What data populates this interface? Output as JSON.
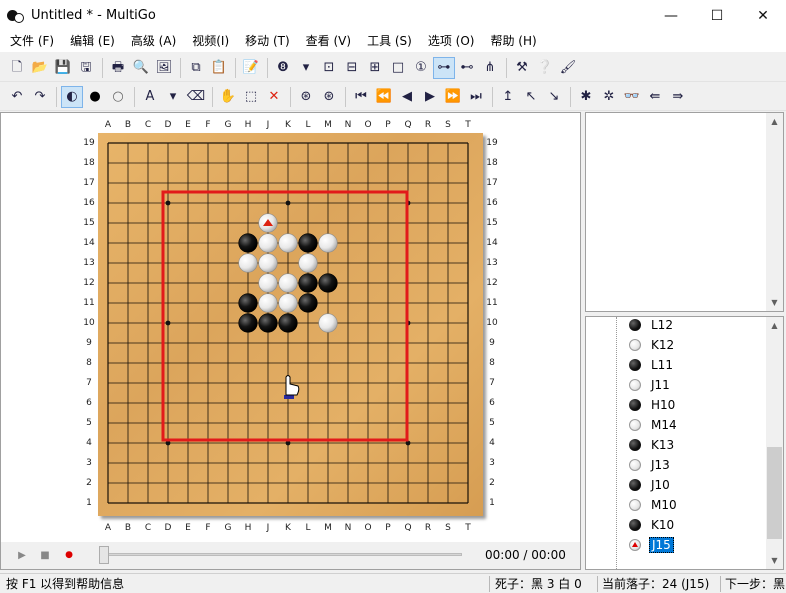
{
  "window": {
    "title": "Untitled  * - MultiGo",
    "icons": {
      "minimize": "minimize-icon",
      "maximize": "maximize-icon",
      "close": "close-icon"
    }
  },
  "menu": [
    "文件 (F)",
    "编辑 (E)",
    "高级 (A)",
    "视频(I)",
    "移动 (T)",
    "查看 (V)",
    "工具 (S)",
    "选项 (O)",
    "帮助 (H)"
  ],
  "toolbar1": [
    {
      "name": "new-icon",
      "glyph": "🗋"
    },
    {
      "name": "open-icon",
      "glyph": "📂"
    },
    {
      "name": "save-icon",
      "glyph": "💾"
    },
    {
      "name": "save-as-icon",
      "glyph": "🖫"
    },
    {
      "sep": true
    },
    {
      "name": "print-icon",
      "glyph": "🖶"
    },
    {
      "name": "print-preview-icon",
      "glyph": "🔍"
    },
    {
      "name": "image-icon",
      "glyph": "🖼"
    },
    {
      "sep": true
    },
    {
      "name": "copy-icon",
      "glyph": "⧉"
    },
    {
      "name": "paste-icon",
      "glyph": "📋"
    },
    {
      "sep": true
    },
    {
      "name": "properties-icon",
      "glyph": "📝"
    },
    {
      "sep": true
    },
    {
      "name": "move-number-icon",
      "glyph": "❽"
    },
    {
      "name": "dropdown-arrow-icon",
      "glyph": "▾"
    },
    {
      "name": "coordinates-icon",
      "glyph": "⊡"
    },
    {
      "name": "board-frame-icon",
      "glyph": "⊟"
    },
    {
      "name": "board-grid-icon",
      "glyph": "⊞"
    },
    {
      "name": "blank-board-icon",
      "glyph": "□"
    },
    {
      "name": "number-one-icon",
      "glyph": "①"
    },
    {
      "name": "tree-view-icon",
      "glyph": "⊶",
      "active": true
    },
    {
      "name": "branch-view-icon",
      "glyph": "⊷"
    },
    {
      "name": "hierarchy-icon",
      "glyph": "⋔"
    },
    {
      "sep": true
    },
    {
      "name": "tools-icon",
      "glyph": "⚒"
    },
    {
      "name": "help-icon",
      "glyph": "❔"
    },
    {
      "name": "brush-icon",
      "glyph": "🖌"
    }
  ],
  "toolbar2": [
    {
      "name": "undo-icon",
      "glyph": "↶"
    },
    {
      "name": "redo-icon",
      "glyph": "↷"
    },
    {
      "sep": true
    },
    {
      "name": "alternate-stones-icon",
      "glyph": "◐",
      "active": true
    },
    {
      "name": "black-stone-icon",
      "glyph": "●"
    },
    {
      "name": "white-stone-icon",
      "glyph": "○"
    },
    {
      "sep": true
    },
    {
      "name": "label-icon",
      "glyph": "A"
    },
    {
      "name": "label-dropdown-icon",
      "glyph": "▾"
    },
    {
      "name": "eraser-icon",
      "glyph": "⌫"
    },
    {
      "sep": true
    },
    {
      "name": "hand-icon",
      "glyph": "✋"
    },
    {
      "name": "region-select-icon",
      "glyph": "⬚"
    },
    {
      "name": "delete-icon",
      "glyph": "✕"
    },
    {
      "sep": true
    },
    {
      "name": "move-left-icon",
      "glyph": "⊛"
    },
    {
      "name": "move-right-icon",
      "glyph": "⊛"
    },
    {
      "sep": true
    },
    {
      "name": "first-move-icon",
      "glyph": "⏮"
    },
    {
      "name": "fast-back-icon",
      "glyph": "⏪"
    },
    {
      "name": "back-icon",
      "glyph": "◀"
    },
    {
      "name": "forward-icon",
      "glyph": "▶"
    },
    {
      "name": "fast-forward-icon",
      "glyph": "⏩"
    },
    {
      "name": "last-move-icon",
      "glyph": "⏭"
    },
    {
      "sep": true
    },
    {
      "name": "branch-up-icon",
      "glyph": "↥"
    },
    {
      "name": "branch-prev-icon",
      "glyph": "↖"
    },
    {
      "name": "branch-next-icon",
      "glyph": "↘"
    },
    {
      "sep": true
    },
    {
      "name": "search-comment-icon",
      "glyph": "✱"
    },
    {
      "name": "search-pattern-icon",
      "glyph": "✲"
    },
    {
      "name": "binoculars-icon",
      "glyph": "👓"
    },
    {
      "name": "search-prev-icon",
      "glyph": "⇚"
    },
    {
      "name": "search-next-icon",
      "glyph": "⇛"
    }
  ],
  "board": {
    "size": 19,
    "columns": [
      "A",
      "B",
      "C",
      "D",
      "E",
      "F",
      "G",
      "H",
      "J",
      "K",
      "L",
      "M",
      "N",
      "O",
      "P",
      "Q",
      "R",
      "S",
      "T"
    ],
    "rows": [
      "19",
      "18",
      "17",
      "16",
      "15",
      "14",
      "13",
      "12",
      "11",
      "10",
      "9",
      "8",
      "7",
      "6",
      "5",
      "4",
      "3",
      "2",
      "1"
    ],
    "hoshi": [
      "D16",
      "K16",
      "Q16",
      "D10",
      "K10",
      "Q10",
      "D4",
      "K4",
      "Q4"
    ],
    "stones": [
      {
        "at": "J15",
        "color": "white",
        "last": true
      },
      {
        "at": "H14",
        "color": "black"
      },
      {
        "at": "J14",
        "color": "white"
      },
      {
        "at": "K14",
        "color": "white"
      },
      {
        "at": "L14",
        "color": "black"
      },
      {
        "at": "M14",
        "color": "white"
      },
      {
        "at": "H13",
        "color": "white"
      },
      {
        "at": "J13",
        "color": "white"
      },
      {
        "at": "L13",
        "color": "white"
      },
      {
        "at": "J12",
        "color": "white"
      },
      {
        "at": "K12",
        "color": "white"
      },
      {
        "at": "L12",
        "color": "black"
      },
      {
        "at": "M12",
        "color": "black"
      },
      {
        "at": "H11",
        "color": "black"
      },
      {
        "at": "J11",
        "color": "white"
      },
      {
        "at": "K11",
        "color": "white"
      },
      {
        "at": "L11",
        "color": "black"
      },
      {
        "at": "H10",
        "color": "black"
      },
      {
        "at": "J10",
        "color": "black"
      },
      {
        "at": "K10",
        "color": "black"
      },
      {
        "at": "M10",
        "color": "white"
      }
    ],
    "region": {
      "from": "D16",
      "to": "Q4",
      "color": "#e21a1a"
    },
    "cursor": {
      "at": "K7",
      "name": "hand-cursor-icon"
    }
  },
  "playback": {
    "play": "play-icon",
    "stop": "stop-icon",
    "record": "record-icon",
    "time": "00:00 / 00:00"
  },
  "move_list": [
    {
      "label": "L12",
      "color": "black"
    },
    {
      "label": "K12",
      "color": "white"
    },
    {
      "label": "L11",
      "color": "black"
    },
    {
      "label": "J11",
      "color": "white"
    },
    {
      "label": "H10",
      "color": "black"
    },
    {
      "label": "M14",
      "color": "white"
    },
    {
      "label": "K13",
      "color": "black"
    },
    {
      "label": "J13",
      "color": "white"
    },
    {
      "label": "J10",
      "color": "black"
    },
    {
      "label": "M10",
      "color": "white"
    },
    {
      "label": "K10",
      "color": "black"
    },
    {
      "label": "J15",
      "color": "marked",
      "selected": true
    }
  ],
  "status": {
    "help": "按 F1 以得到帮助信息",
    "captures": "死子：黑 3 白 0",
    "current": "当前落子：24 (J15)",
    "next": "下一步：黑"
  }
}
